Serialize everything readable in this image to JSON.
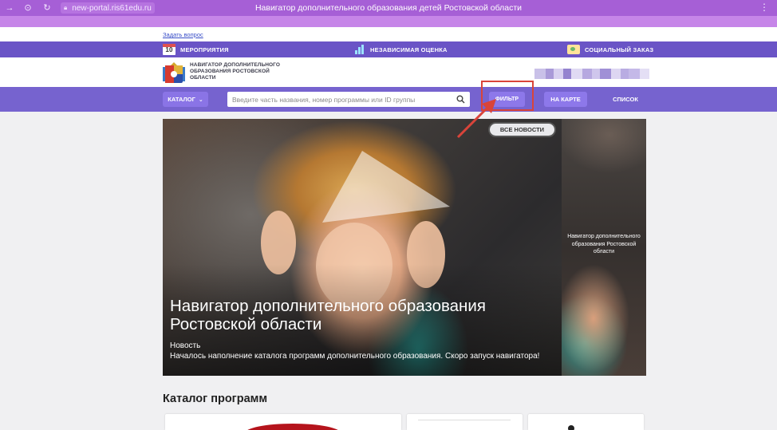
{
  "browser": {
    "url": "new-portal.ris61edu.ru",
    "title": "Навигатор дополнительного образования детей Ростовской области"
  },
  "ask_link": "Задать вопрос",
  "topnav": {
    "events_day": "10",
    "events": "МЕРОПРИЯТИЯ",
    "assessment": "НЕЗАВИСИМАЯ ОЦЕНКА",
    "social_order": "СОЦИАЛЬНЫЙ ЗАКАЗ"
  },
  "header": {
    "logo_text": "НАВИГАТОР ДОПОЛНИТЕЛЬНОГО ОБРАЗОВАНИЯ РОСТОВСКОЙ ОБЛАСТИ"
  },
  "searchbar": {
    "catalog_label": "КАТАЛОГ",
    "search_placeholder": "Введите часть названия, номер программы или ID группы",
    "filter_label": "ФИЛЬТР",
    "map_label": "НА КАРТЕ",
    "list_label": "СПИСОК"
  },
  "hero": {
    "all_news_label": "ВСЕ НОВОСТИ",
    "title": "Навигатор дополнительного образования Ростовской области",
    "tag": "Новость",
    "text": "Началось наполнение каталога программ дополнительного образования. Скоро запуск навигатора!",
    "side_text": "Навигатор дополнительного образования Ростовской области"
  },
  "catalog": {
    "title": "Каталог программ"
  },
  "colors": {
    "browser_bar": "#a65fd6",
    "nav": "#6a54c6",
    "search_band": "#7663cf",
    "button": "#8d78ea",
    "highlight": "#d9443a"
  }
}
